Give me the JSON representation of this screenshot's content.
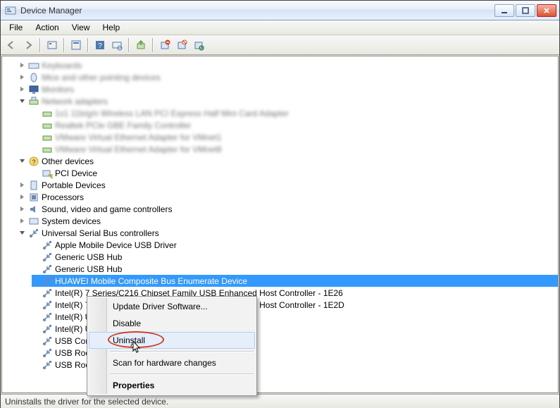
{
  "window": {
    "title": "Device Manager"
  },
  "menubar": [
    "File",
    "Action",
    "View",
    "Help"
  ],
  "categories": {
    "keyboards": "Keyboards",
    "mice": "Mice and other pointing devices",
    "monitors": "Monitors",
    "net": "Network adapters",
    "net_items": [
      "1x1 11b/g/n Wireless LAN PCI Express Half Mini Card Adapter",
      "Realtek PCIe GBE Family Controller",
      "VMware Virtual Ethernet Adapter for VMnet1",
      "VMware Virtual Ethernet Adapter for VMnet8"
    ],
    "other": "Other devices",
    "pcidev": "PCI Device",
    "portable": "Portable Devices",
    "processors": "Processors",
    "sound": "Sound, video and game controllers",
    "system": "System devices",
    "usb": "Universal Serial Bus controllers",
    "usb_items": [
      "Apple Mobile Device USB Driver",
      "Generic USB Hub",
      "Generic USB Hub",
      "HUAWEI Mobile Composite Bus Enumerate Device",
      "Intel(R) 7 Series/C216 Chipset Family USB Enhanced Host Controller - 1E26",
      "Intel(R) 7 Series/C216 Chipset Family USB Enhanced Host Controller - 1E2D",
      "Intel(R) USB 3.0 eXtensible Host Controller",
      "Intel(R) USB 3.0 Root Hub",
      "USB Composite Device",
      "USB Root Hub",
      "USB Root Hub"
    ]
  },
  "context_menu": {
    "update": "Update Driver Software...",
    "disable": "Disable",
    "uninstall": "Uninstall",
    "scan": "Scan for hardware changes",
    "properties": "Properties"
  },
  "statusbar": "Uninstalls the driver for the selected device."
}
